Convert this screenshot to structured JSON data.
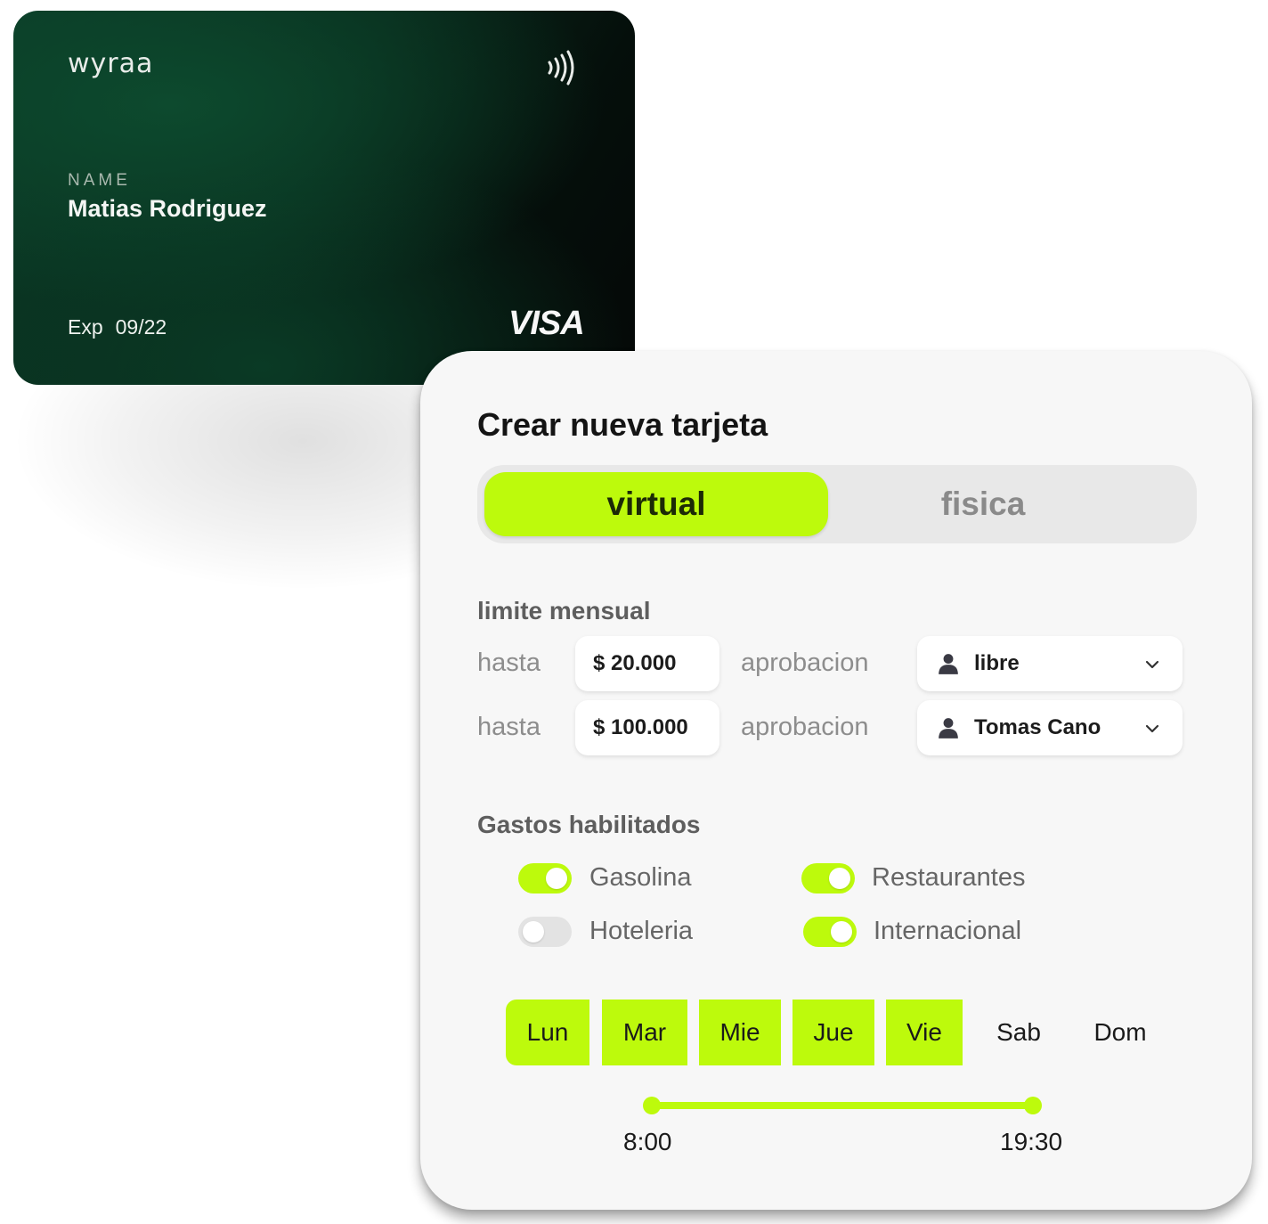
{
  "card": {
    "brand_logo": "wyraa",
    "contactless_icon": "contactless-icon",
    "name_label": "NAME",
    "holder_name": "Matias Rodriguez",
    "exp_label": "Exp",
    "exp_value": "09/22",
    "network": "VISA"
  },
  "panel": {
    "title": "Crear nueva tarjeta",
    "tabs": [
      {
        "label": "virtual",
        "active": true
      },
      {
        "label": "fisica",
        "active": false
      }
    ],
    "limit_section_label": "limite mensual",
    "limits": [
      {
        "prefix": "hasta",
        "amount": "$ 20.000",
        "approval_label": "aprobacion",
        "approver": "libre"
      },
      {
        "prefix": "hasta",
        "amount": "$ 100.000",
        "approval_label": "aprobacion",
        "approver": "Tomas Cano"
      }
    ],
    "expenses_section_label": "Gastos habilitados",
    "expenses": [
      {
        "label": "Gasolina",
        "enabled": true
      },
      {
        "label": "Restaurantes",
        "enabled": true
      },
      {
        "label": "Hoteleria",
        "enabled": false
      },
      {
        "label": "Internacional",
        "enabled": true
      }
    ],
    "days": [
      {
        "label": "Lun",
        "selected": true
      },
      {
        "label": "Mar",
        "selected": true
      },
      {
        "label": "Mie",
        "selected": true
      },
      {
        "label": "Jue",
        "selected": true
      },
      {
        "label": "Vie",
        "selected": true
      },
      {
        "label": "Sab",
        "selected": false
      },
      {
        "label": "Dom",
        "selected": false
      }
    ],
    "time_range": {
      "start": "8:00",
      "end": "19:30"
    }
  },
  "colors": {
    "accent": "#bdfa0c",
    "card_dark_green": "#0b3a26",
    "panel_bg": "#f7f7f7"
  }
}
